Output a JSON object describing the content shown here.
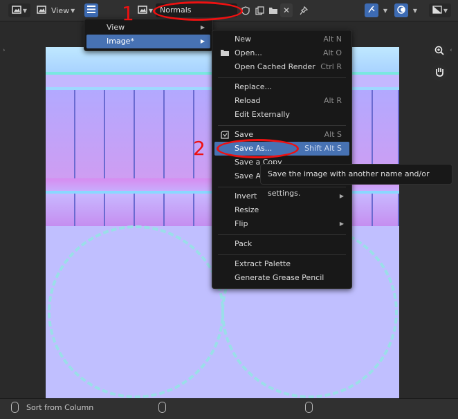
{
  "header": {
    "editor_type_icon": "image-editor-icon",
    "view_mode_icon": "image-view-icon",
    "view_menu_label": "View",
    "menu_icon": "hamburger-icon",
    "image_browse_icon": "image-browse-icon",
    "image_name": "Normals",
    "fake_user_icon": "shield-icon",
    "duplicate_icon": "duplicate-icon",
    "open_icon": "folder-icon",
    "unlink_icon": "close-icon",
    "pin_icon": "pin-icon",
    "gizmo_icon": "gizmo-icon",
    "overlay_icon": "overlay-icon",
    "display_channels_icon": "display-channels-icon"
  },
  "image_menu": {
    "items": [
      {
        "label": "View",
        "has_submenu": true
      },
      {
        "label": "Image*",
        "has_submenu": true,
        "highlighted": true
      }
    ]
  },
  "image_submenu": {
    "items": [
      {
        "label": "New",
        "shortcut": "Alt N"
      },
      {
        "label": "Open...",
        "shortcut": "Alt O",
        "icon": "folder-icon"
      },
      {
        "label": "Open Cached Render",
        "shortcut": "Ctrl R"
      },
      {
        "label": "Replace..."
      },
      {
        "label": "Reload",
        "shortcut": "Alt R"
      },
      {
        "label": "Edit Externally"
      },
      {
        "label": "Save",
        "shortcut": "Alt S",
        "icon": "save-icon"
      },
      {
        "label": "Save As...",
        "shortcut": "Shift Alt S",
        "highlighted": true
      },
      {
        "label": "Save a Copy"
      },
      {
        "label": "Save A"
      },
      {
        "label": "Invert",
        "has_submenu": true
      },
      {
        "label": "Resize"
      },
      {
        "label": "Flip",
        "has_submenu": true
      },
      {
        "label": "Pack"
      },
      {
        "label": "Extract Palette"
      },
      {
        "label": "Generate Grease Pencil"
      }
    ]
  },
  "tooltip": "Save the image with another name and/or settings.",
  "status_bar": {
    "left_text": "Sort from Column"
  },
  "tools": {
    "zoom_icon": "zoom-icon",
    "hand_icon": "hand-icon"
  },
  "annotations": {
    "number_1": "1",
    "number_2": "2"
  },
  "colors": {
    "accent": "#4772b3",
    "annotation": "#ee1111",
    "texture_base": "#c0bfff"
  }
}
